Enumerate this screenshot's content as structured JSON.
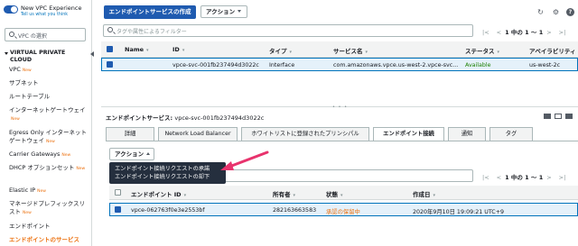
{
  "sidebar": {
    "experience_toggle_label": "New VPC Experience",
    "experience_feedback_link": "Tell us what you think",
    "vpc_select_placeholder": "VPC の選択",
    "section_header": "VIRTUAL PRIVATE CLOUD",
    "new_badge": "New",
    "items": [
      {
        "label": "VPC",
        "new": true
      },
      {
        "label": "サブネット",
        "new": false
      },
      {
        "label": "ルートテーブル",
        "new": false
      },
      {
        "label": "インターネットゲートウェイ",
        "new": true
      },
      {
        "label": "Egress Only インターネットゲートウェイ",
        "new": true
      },
      {
        "label": "Carrier Gateways",
        "new": true
      },
      {
        "label": "DHCP オプションセット",
        "new": true
      },
      {
        "label": "Elastic IP",
        "new": true
      },
      {
        "label": "マネージドプレフィックスリスト",
        "new": true
      },
      {
        "label": "エンドポイント",
        "new": false
      },
      {
        "label": "エンドポイントのサービス",
        "new": false,
        "active": true
      }
    ]
  },
  "toolbar": {
    "create_button": "エンドポイントサービスの作成",
    "action_button": "アクション",
    "refresh_icon": "refresh-icon",
    "settings_icon": "gear-icon",
    "help_icon": "help-icon"
  },
  "filter": {
    "placeholder": "タグや属性によるフィルター",
    "pagination": "1 中の 1 ～ 1"
  },
  "main_table": {
    "columns": [
      "Name",
      "ID",
      "タイプ",
      "サービス名",
      "ステータス",
      "アベイラビリティ"
    ],
    "rows": [
      {
        "name": "",
        "id": "vpce-svc-001fb237494d3022c",
        "type": "Interface",
        "service": "com.amazonaws.vpce.us-west-2.vpce-svc...",
        "status": "Available",
        "az": "us-west-2c"
      }
    ]
  },
  "details": {
    "title_label": "エンドポイントサービス:",
    "title_id": "vpce-svc-001fb237494d3022c",
    "tabs": [
      "詳細",
      "Network Load Balancer",
      "ホワイトリストに登録されたプリンシパル",
      "エンドポイント接続",
      "通知",
      "タグ"
    ],
    "active_tab": "エンドポイント接続",
    "action_button": "アクション",
    "action_menu": [
      "エンドポイント接続リクエストの承諾",
      "エンドポイント接続リクエストの却下"
    ],
    "pagination": "1 中の 1 ～ 1",
    "columns": [
      "エンドポイント ID",
      "所有者",
      "状態",
      "作成日"
    ],
    "rows": [
      {
        "endpoint_id": "vpce-062763f0e3e2553bf",
        "owner": "282163663583",
        "state": "承認の保留中",
        "created": "2020年9月10日 19:09:21 UTC+9"
      }
    ]
  },
  "colors": {
    "primary": "#1f5bb0",
    "status_available": "#1d8102",
    "status_pending": "#ec7211",
    "annotation_arrow": "#e8336d"
  }
}
